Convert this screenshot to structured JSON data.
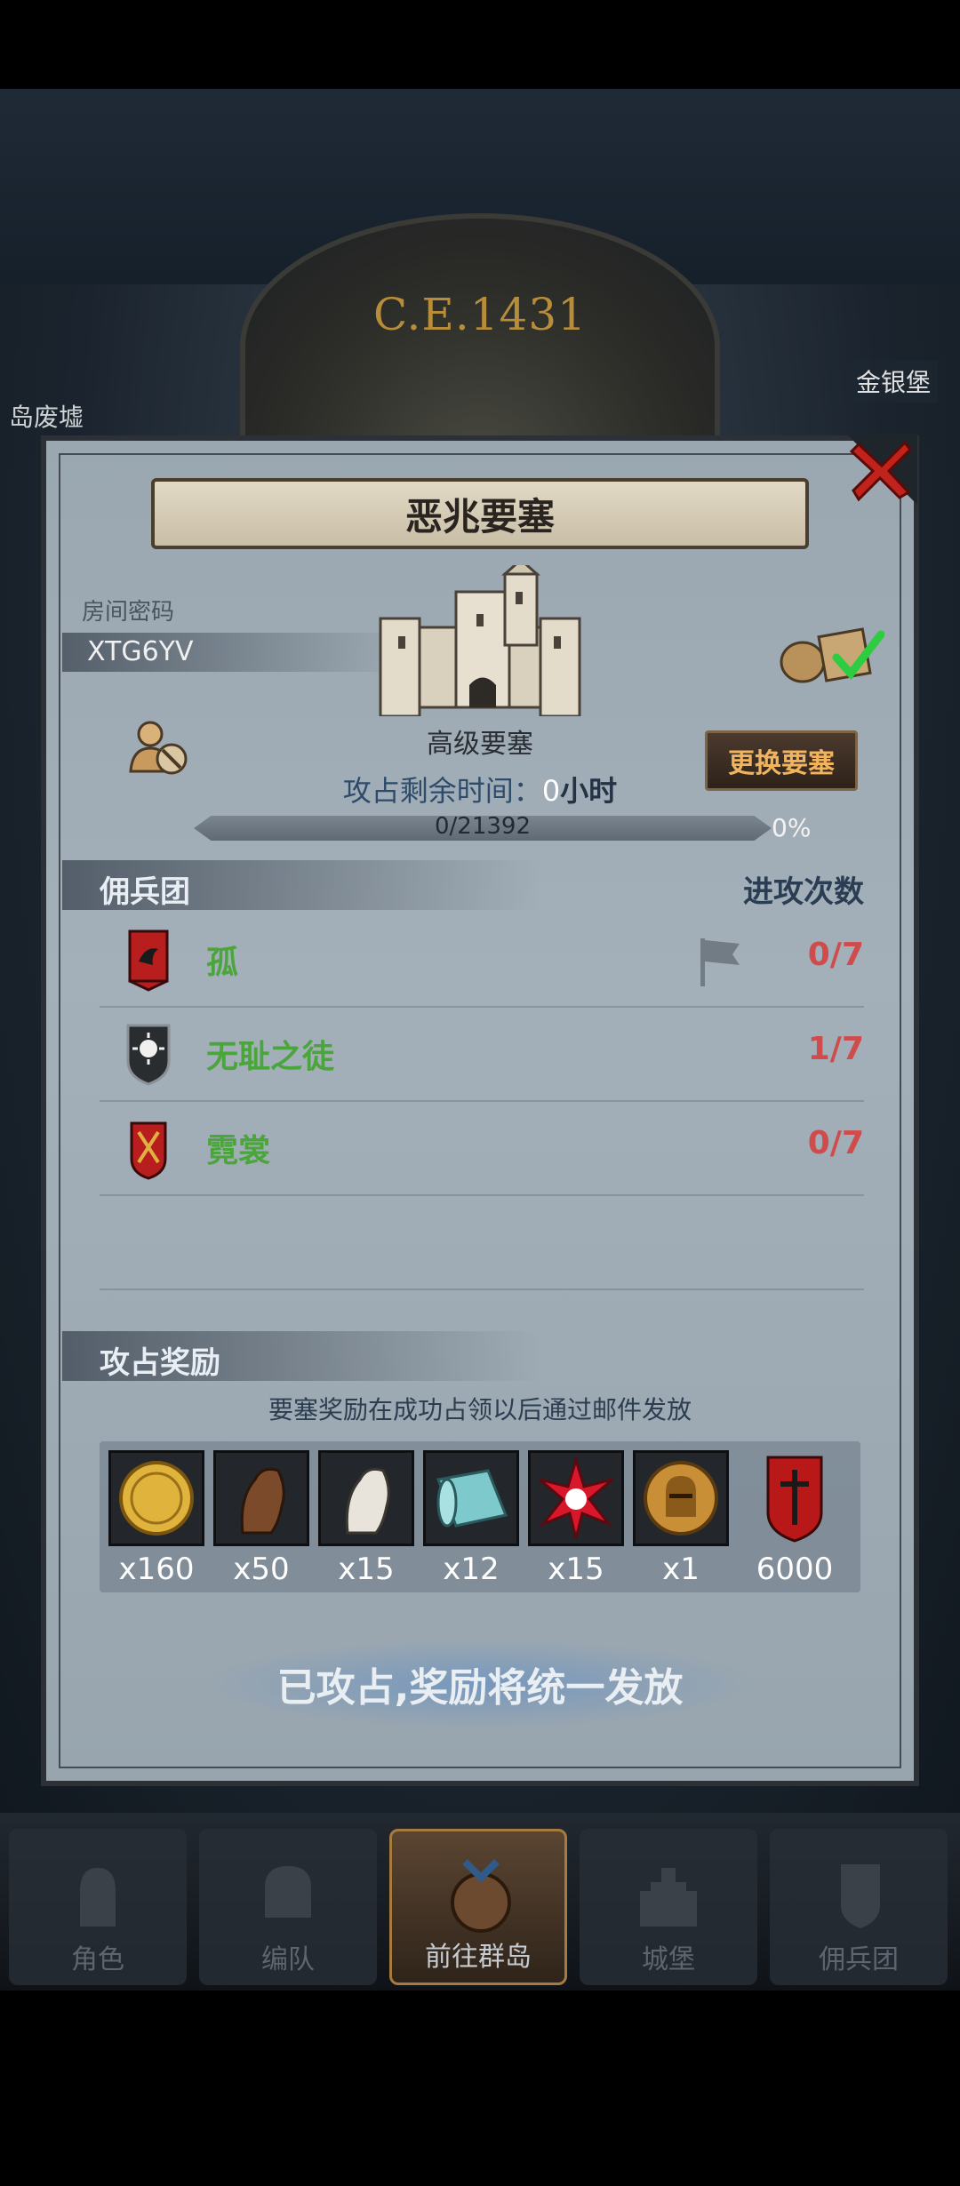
{
  "header": {
    "era": "C.E.1431",
    "location_left": "岛废墟",
    "location_right": "金银堡"
  },
  "dialog": {
    "title": "恶兆要塞",
    "room_label": "房间密码",
    "room_code": "XTG6YV",
    "fortress_type": "高级要塞",
    "time_label": "攻占剩余时间：",
    "time_value": "0",
    "time_unit": "小时",
    "change_button": "更换要塞",
    "progress_text": "0/21392",
    "progress_percent": "0%",
    "progress_value": 0
  },
  "mercenaries": {
    "header_left": "佣兵团",
    "header_right": "进攻次数",
    "rows": [
      {
        "name": "孤",
        "count": "0/7",
        "icon": "raven-banner-icon"
      },
      {
        "name": "无耻之徒",
        "count": "1/7",
        "icon": "sun-shield-icon"
      },
      {
        "name": "霓裳",
        "count": "0/7",
        "icon": "torch-banner-icon"
      }
    ]
  },
  "rewards": {
    "header": "攻占奖励",
    "note": "要塞奖励在成功占领以后通过邮件发放",
    "items": [
      {
        "icon": "gold-coin-icon",
        "qty": "x160"
      },
      {
        "icon": "brown-horse-icon",
        "qty": "x50"
      },
      {
        "icon": "white-horse-icon",
        "qty": "x15"
      },
      {
        "icon": "cloth-roll-icon",
        "qty": "x12"
      },
      {
        "icon": "red-star-gem-icon",
        "qty": "x15"
      },
      {
        "icon": "knight-medal-icon",
        "qty": "x1"
      },
      {
        "icon": "red-banner-icon",
        "qty": "6000"
      }
    ]
  },
  "status_button": "已攻占,奖励将统一发放",
  "nav": {
    "items": [
      {
        "label": "角色"
      },
      {
        "label": "编队"
      },
      {
        "label": "前往群岛"
      },
      {
        "label": "城堡"
      },
      {
        "label": "佣兵团"
      }
    ]
  },
  "colors": {
    "accent_gold": "#f0b35e",
    "count_red": "#d04b4b",
    "name_green": "#4aa53a"
  }
}
